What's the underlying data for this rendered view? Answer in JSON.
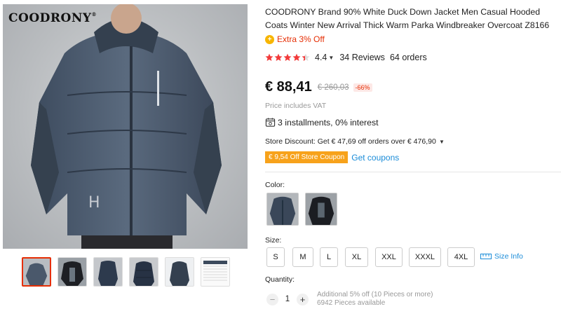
{
  "gallery": {
    "brand_logo": "COODRONY",
    "thumbnails": [
      "thumb-1",
      "thumb-2",
      "thumb-3",
      "thumb-4",
      "thumb-5",
      "thumb-6"
    ],
    "active_thumbnail": 0
  },
  "product": {
    "title": "COODRONY Brand 90% White Duck Down Jacket Men Casual Hooded Coats Winter New Arrival Thick Warm Parka Windbreaker Overcoat Z8166",
    "promo_icon": "+",
    "promo_text": "Extra 3% Off",
    "rating": 4.4,
    "rating_text": "4.4",
    "reviews_text": "34 Reviews",
    "orders_text": "64 orders",
    "price": "€ 88,41",
    "old_price": "€ 260,03",
    "discount": "-66%",
    "vat_note": "Price includes VAT",
    "installments": "3 installments, 0% interest",
    "store_discount": "Store Discount: Get € 47,69 off orders over € 476,90",
    "coupon_badge": "€ 9,54 Off Store Coupon",
    "get_coupons": "Get coupons"
  },
  "options": {
    "color_label": "Color:",
    "colors": [
      "dark-navy",
      "black"
    ],
    "size_label": "Size:",
    "sizes": [
      "S",
      "M",
      "L",
      "XL",
      "XXL",
      "XXXL",
      "4XL"
    ],
    "size_info": "Size Info",
    "quantity_label": "Quantity:",
    "quantity": "1",
    "minus": "−",
    "plus": "+",
    "bulk_note": "Additional 5% off (10 Pieces or more)",
    "stock_note": "6942 Pieces available"
  },
  "colors": {
    "accent_red": "#e62e04",
    "link_blue": "#1a8cd8",
    "coupon_orange": "#f7a21b",
    "star_red": "#f23a3a"
  }
}
